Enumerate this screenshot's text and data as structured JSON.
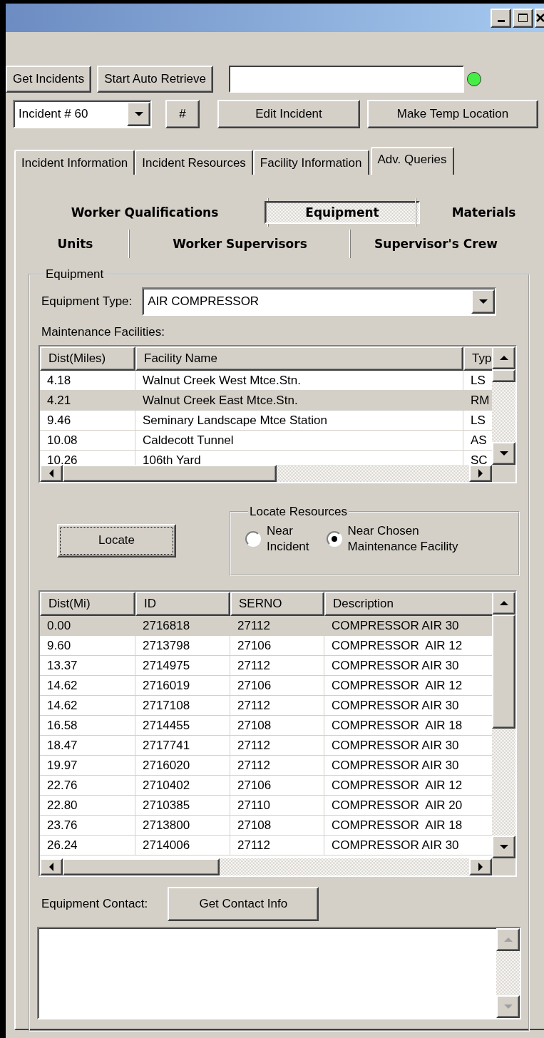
{
  "toolbar": {
    "buttons": [
      {
        "label": "Get Incidents"
      },
      {
        "label": "Start Auto Retrieve"
      }
    ],
    "connected": true
  },
  "incident_bar": {
    "incident_select": "Incident # 60",
    "number_button": "#",
    "buttons": [
      {
        "label": "Edit Incident"
      },
      {
        "label": "Make Temp Location"
      }
    ]
  },
  "tabs": [
    {
      "label": "Incident Information",
      "selected": false
    },
    {
      "label": "Incident Resources",
      "selected": false
    },
    {
      "label": "Facility Information",
      "selected": false
    },
    {
      "label": "Adv. Queries",
      "selected": true
    }
  ],
  "query_tabs": [
    [
      {
        "label": "Worker Qualifications",
        "selected": false
      },
      {
        "label": "Equipment",
        "selected": true
      },
      {
        "label": "Materials",
        "selected": false
      }
    ],
    [
      {
        "label": "Units",
        "selected": false
      },
      {
        "label": "Worker Supervisors",
        "selected": false
      },
      {
        "label": "Supervisor's Crew",
        "selected": false
      }
    ]
  ],
  "equipment_group": {
    "legend": "Equipment",
    "type_label": "Equipment Type:",
    "type_value": "AIR COMPRESSOR",
    "facilities_label": "Maintenance Facilities:",
    "facilities": {
      "columns": [
        "Dist(Miles)",
        "Facility Name",
        "Typ"
      ],
      "rows": [
        {
          "cells": [
            "4.18",
            "Walnut Creek West Mtce.Stn.",
            "LS"
          ],
          "selected": false
        },
        {
          "cells": [
            "4.21",
            "Walnut Creek East Mtce.Stn.",
            "RM"
          ],
          "selected": true
        },
        {
          "cells": [
            "9.46",
            "Seminary Landscape Mtce Station",
            "LS"
          ],
          "selected": false
        },
        {
          "cells": [
            "10.08",
            "Caldecott Tunnel",
            "AS"
          ],
          "selected": false
        },
        {
          "cells": [
            "10.26",
            "106th Yard",
            "SC"
          ],
          "selected": false
        }
      ]
    },
    "locate_button": {
      "label": "Locate",
      "focused": true
    },
    "locate_resources": {
      "legend": "Locate Resources",
      "options": [
        {
          "label": "Near\nIncident",
          "selected": false
        },
        {
          "label": "Near Chosen\nMaintenance Facility",
          "selected": true
        }
      ]
    },
    "equipment": {
      "columns": [
        "Dist(Mi)",
        "ID",
        "SERNO",
        "Description"
      ],
      "rows": [
        {
          "cells": [
            "0.00",
            "2716818",
            "27112",
            "COMPRESSOR AIR 30"
          ],
          "selected": true
        },
        {
          "cells": [
            "9.60",
            "2713798",
            "27106",
            "COMPRESSOR  AIR 12"
          ],
          "selected": false
        },
        {
          "cells": [
            "13.37",
            "2714975",
            "27112",
            "COMPRESSOR AIR 30"
          ],
          "selected": false
        },
        {
          "cells": [
            "14.62",
            "2716019",
            "27106",
            "COMPRESSOR  AIR 12"
          ],
          "selected": false
        },
        {
          "cells": [
            "14.62",
            "2717108",
            "27112",
            "COMPRESSOR AIR 30"
          ],
          "selected": false
        },
        {
          "cells": [
            "16.58",
            "2714455",
            "27108",
            "COMPRESSOR  AIR 18"
          ],
          "selected": false
        },
        {
          "cells": [
            "18.47",
            "2717741",
            "27112",
            "COMPRESSOR AIR 30"
          ],
          "selected": false
        },
        {
          "cells": [
            "19.97",
            "2716020",
            "27112",
            "COMPRESSOR AIR 30"
          ],
          "selected": false
        },
        {
          "cells": [
            "22.76",
            "2710402",
            "27106",
            "COMPRESSOR  AIR 12"
          ],
          "selected": false
        },
        {
          "cells": [
            "22.80",
            "2710385",
            "27110",
            "COMPRESSOR  AIR 20"
          ],
          "selected": false
        },
        {
          "cells": [
            "23.76",
            "2713800",
            "27108",
            "COMPRESSOR  AIR 18"
          ],
          "selected": false
        },
        {
          "cells": [
            "26.24",
            "2714006",
            "27112",
            "COMPRESSOR AIR 30"
          ],
          "selected": false
        }
      ]
    },
    "contact_label": "Equipment Contact:",
    "contact_button": {
      "label": "Get Contact Info"
    }
  }
}
